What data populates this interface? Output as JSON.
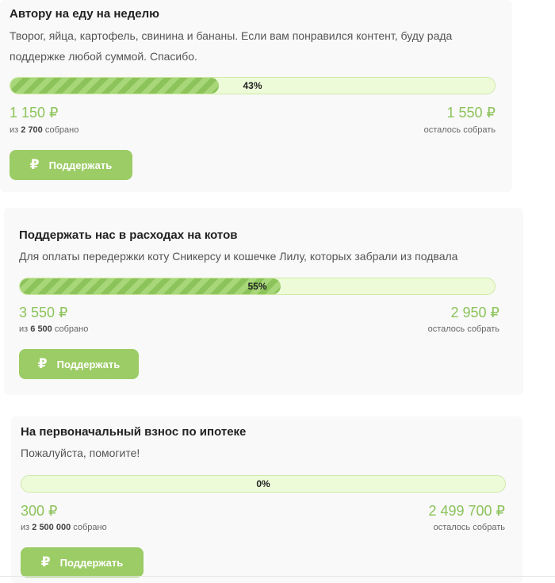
{
  "cards": [
    {
      "title": "Автору на еду на неделю",
      "description": "Творог, яйца, картофель, свинина и бананы. Если вам понравился контент, буду рада поддержке любой суммой. Спасибо.",
      "percent": 43,
      "percent_label": "43%",
      "collected": "1 150 ₽",
      "goal_prefix": "из",
      "goal": "2 700",
      "goal_suffix": "собрано",
      "remaining": "1 550 ₽",
      "remaining_label": "осталось собрать",
      "button_label": "Поддержать",
      "button_icon": "ruble-icon"
    },
    {
      "title": "Поддержать нас в расходах на котов",
      "description": "Для оплаты передержки коту Сникерсу и кошечке Лилу, которых забрали из подвала",
      "percent": 55,
      "percent_label": "55%",
      "collected": "3 550 ₽",
      "goal_prefix": "из",
      "goal": "6 500",
      "goal_suffix": "собрано",
      "remaining": "2 950 ₽",
      "remaining_label": "осталось собрать",
      "button_label": "Поддержать",
      "button_icon": "ruble-icon"
    },
    {
      "title": "На первоначальный взнос по ипотеке",
      "description": "Пожалуйста, помогите!",
      "percent": 0,
      "percent_label": "0%",
      "collected": "300 ₽",
      "goal_prefix": "из",
      "goal": "2 500 000",
      "goal_suffix": "собрано",
      "remaining": "2 499 700 ₽",
      "remaining_label": "осталось собрать",
      "button_label": "Поддержать",
      "button_icon": "ruble-icon"
    }
  ],
  "colors": {
    "accent": "#8cc35a",
    "button": "#9ccc65",
    "progress_bg": "#eefbd9",
    "card_bg": "#f9f9f9"
  }
}
